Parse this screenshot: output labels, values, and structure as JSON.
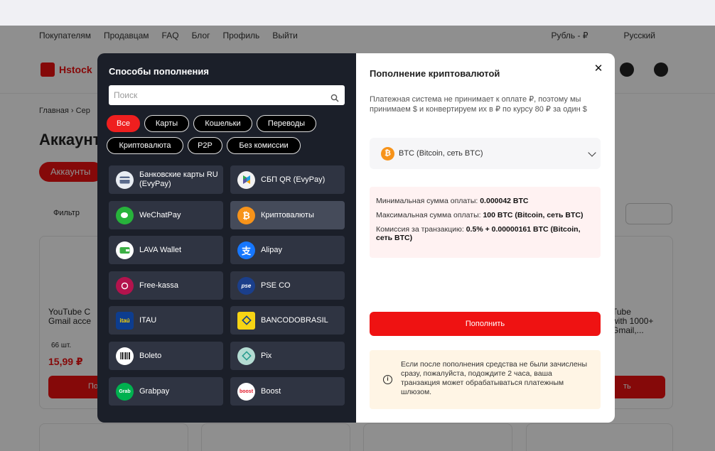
{
  "site": {
    "nav": [
      "Покупателям",
      "Продавцам",
      "FAQ",
      "Блог",
      "Профиль",
      "Выйти"
    ],
    "currency": "Рубль - ₽",
    "language": "Русский",
    "logo": "Hstock",
    "breadcrumb": "Главная  ›  Сер",
    "page_title": "Аккаунт",
    "tab_accounts": "Аккаунты",
    "filter": "Фильтр",
    "card_left_title": "YouTube C\nGmail acce",
    "card_left_qty": "66 шт.",
    "card_left_price": "15,99 ₽",
    "card_left_btn": "По",
    "card_right_title": "Tube\nwith 1000+\nGmail,...",
    "card_right_btn": "ть"
  },
  "modal": {
    "left": {
      "title": "Способы пополнения",
      "search_placeholder": "Поиск",
      "chips": [
        "Все",
        "Карты",
        "Кошельки",
        "Переводы",
        "Криптовалюта",
        "P2P",
        "Без комиссии"
      ],
      "methods": [
        {
          "label": "Банковские карты RU (EvyPay)",
          "icon": "card-icon"
        },
        {
          "label": "СБП QR (EvyPay)",
          "icon": "sbp-icon"
        },
        {
          "label": "WeChatPay",
          "icon": "wechat-icon"
        },
        {
          "label": "Криптовалюты",
          "icon": "bitcoin-icon"
        },
        {
          "label": "LAVA Wallet",
          "icon": "wallet-icon"
        },
        {
          "label": "Alipay",
          "icon": "alipay-icon"
        },
        {
          "label": "Free-kassa",
          "icon": "freekassa-icon"
        },
        {
          "label": "PSE CO",
          "icon": "pse-icon"
        },
        {
          "label": "ITAU",
          "icon": "itau-icon"
        },
        {
          "label": "BANCODOBRASIL",
          "icon": "bancodobrasil-icon"
        },
        {
          "label": "Boleto",
          "icon": "boleto-icon"
        },
        {
          "label": "Pix",
          "icon": "pix-icon"
        },
        {
          "label": "Grabpay",
          "icon": "grabpay-icon"
        },
        {
          "label": "Boost",
          "icon": "boost-icon"
        }
      ]
    },
    "right": {
      "title": "Пополнение криптовалютой",
      "note": "Платежная система не принимает к оплате ₽, поэтому мы принимаем $ и конвертируем их в ₽ по курсу 80 ₽ за один $",
      "selected_coin": "BTC (Bitcoin, сеть BTC)",
      "min_label": "Минимальная сумма оплаты:",
      "min_value": "0.000042 BTC",
      "max_label": "Максимальная сумма оплаты:",
      "max_value": "100 BTC (Bitcoin, сеть BTC)",
      "fee_label": "Комиссия за транзакцию:",
      "fee_value": "0.5% + 0.00000161 BTC (Bitcoin, сеть BTC)",
      "pay_button": "Пополнить",
      "warning": "Если после пополнения средства не были зачислены сразу, пожалуйста, подождите 2 часа, ваша транзакция может обрабатываться платежным шлюзом."
    }
  },
  "colors": {
    "accent": "#ef1212",
    "modal_dark": "#1b1f29",
    "item_bg": "#2f3442"
  }
}
